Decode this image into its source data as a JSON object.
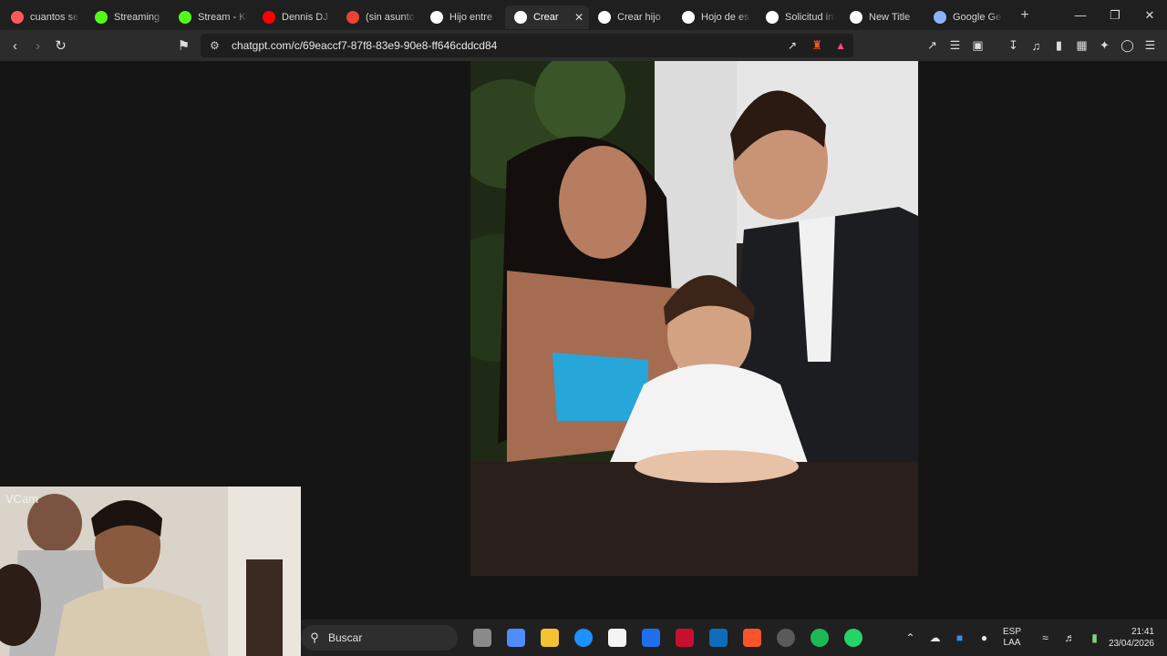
{
  "browser": {
    "tabs": [
      {
        "title": "cuantos se",
        "color": "#ff5a5a"
      },
      {
        "title": "Streaming",
        "color": "#53fc18"
      },
      {
        "title": "Stream - Ki",
        "color": "#53fc18"
      },
      {
        "title": "Dennis DJ",
        "color": "#ff0000"
      },
      {
        "title": "(sin asunto",
        "color": "#ea4335"
      },
      {
        "title": "Hijo entre",
        "color": "#ffffff"
      },
      {
        "title": "Crear",
        "color": "#ffffff",
        "active": true
      },
      {
        "title": "Crear hijo",
        "color": "#ffffff"
      },
      {
        "title": "Hojo de es",
        "color": "#ffffff"
      },
      {
        "title": "Solicitud in",
        "color": "#ffffff"
      },
      {
        "title": "New Title",
        "color": "#ffffff"
      },
      {
        "title": "Google Ge",
        "color": "#8ab4f8"
      }
    ],
    "new_tab": "+",
    "url": "chatgpt.com/c/69eaccf7-87f8-83e9-90e8-ff646cddcd84"
  },
  "webcam": {
    "label": "VCam"
  },
  "taskbar": {
    "search_placeholder": "Buscar",
    "apps": [
      "task-view",
      "copilot",
      "file-explorer",
      "edge",
      "store",
      "vscode",
      "mcafee",
      "outlook",
      "brave",
      "obs",
      "spotify",
      "whatsapp"
    ],
    "app_colors": [
      "#8a8a8a",
      "#4f8cff",
      "#f3c233",
      "#1e90ff",
      "#f4f4f4",
      "#1f6feb",
      "#c8102e",
      "#0f6cbd",
      "#fb542b",
      "#5a5a5a",
      "#1db954",
      "#25d366"
    ],
    "tray": {
      "lang_line1": "ESP",
      "lang_line2": "LAA",
      "time": "21:41",
      "date": "23/04/2026"
    }
  }
}
